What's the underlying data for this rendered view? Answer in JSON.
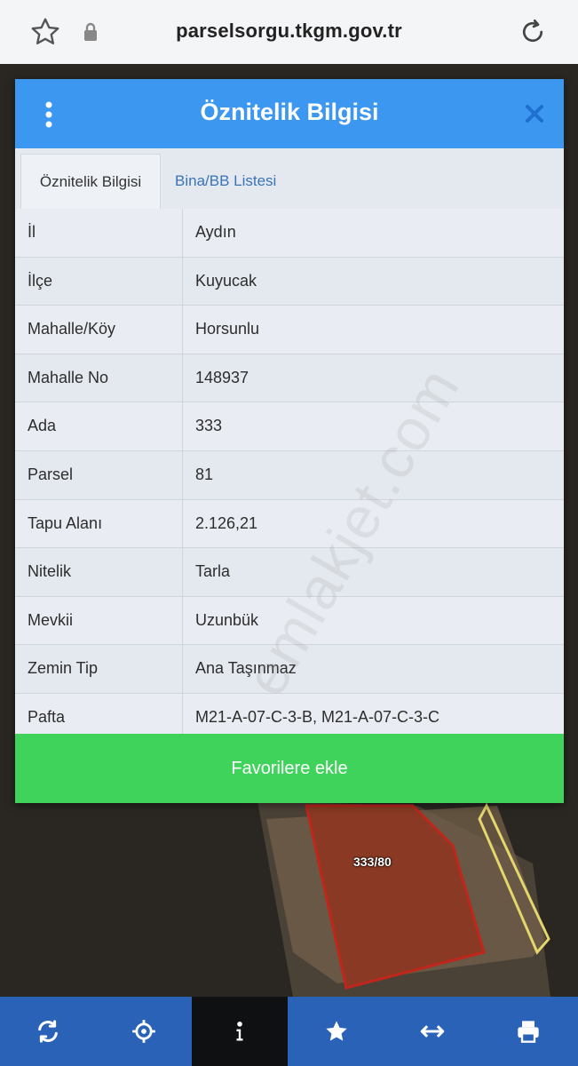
{
  "browser": {
    "url": "parselsorgu.tkgm.gov.tr",
    "icons": {
      "bookmark": "star-icon",
      "secure": "lock-icon",
      "reload": "reload-icon"
    }
  },
  "dialog": {
    "title": "Öznitelik Bilgisi",
    "tabs": [
      {
        "label": "Öznitelik Bilgisi",
        "active": true
      },
      {
        "label": "Bina/BB Listesi",
        "active": false
      }
    ],
    "rows": [
      {
        "key": "İl",
        "value": "Aydın"
      },
      {
        "key": "İlçe",
        "value": "Kuyucak"
      },
      {
        "key": "Mahalle/Köy",
        "value": "Horsunlu"
      },
      {
        "key": "Mahalle No",
        "value": "148937"
      },
      {
        "key": "Ada",
        "value": "333"
      },
      {
        "key": "Parsel",
        "value": "81"
      },
      {
        "key": "Tapu Alanı",
        "value": "2.126,21"
      },
      {
        "key": "Nitelik",
        "value": "Tarla"
      },
      {
        "key": "Mevkii",
        "value": "Uzunbük"
      },
      {
        "key": "Zemin Tip",
        "value": "Ana Taşınmaz"
      },
      {
        "key": "Pafta",
        "value": "M21-A-07-C-3-B, M21-A-07-C-3-C"
      }
    ],
    "favorite_label": "Favorilere ekle",
    "colors": {
      "header": "#3b97f0",
      "favorite": "#40d35c"
    }
  },
  "map": {
    "parcel_label": "333/80",
    "watermark": "emlakjet.com"
  },
  "bottom_toolbar": {
    "items": [
      {
        "icon": "refresh-icon",
        "active": false
      },
      {
        "icon": "locate-icon",
        "active": false
      },
      {
        "icon": "info-icon",
        "active": true
      },
      {
        "icon": "star-icon",
        "active": false
      },
      {
        "icon": "measure-icon",
        "active": false
      },
      {
        "icon": "print-icon",
        "active": false
      }
    ],
    "color": "#2a62b8"
  }
}
